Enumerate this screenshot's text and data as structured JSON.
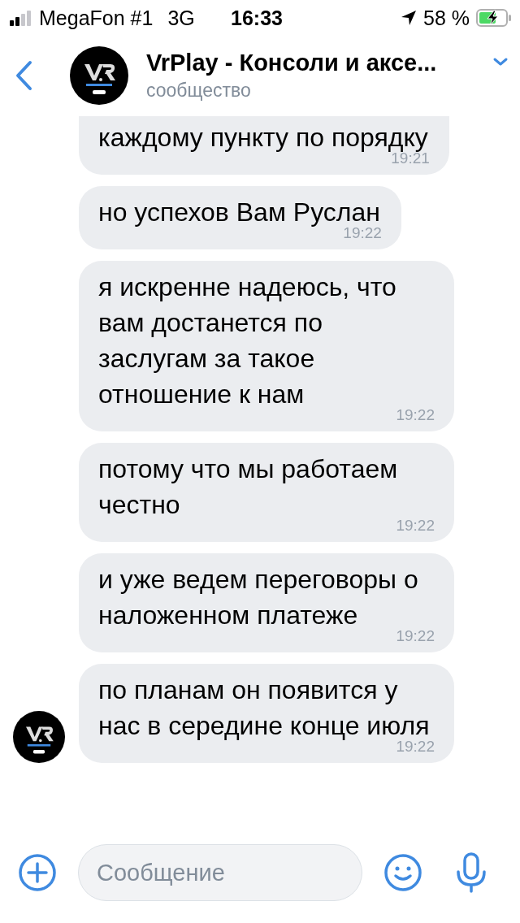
{
  "status_bar": {
    "carrier": "MegaFon #1",
    "network": "3G",
    "time": "16:33",
    "battery": "58 %"
  },
  "header": {
    "title": "VrPlay - Консоли и аксе...",
    "subtitle": "сообщество"
  },
  "messages": [
    {
      "text": "каждому пункту по порядку",
      "time": "19:21",
      "avatar": false
    },
    {
      "text": "но успехов Вам Руслан",
      "time": "19:22",
      "avatar": false
    },
    {
      "text": "я искренне надеюсь, что вам достанется по заслугам за такое отношение к нам",
      "time": "19:22",
      "avatar": false
    },
    {
      "text": "потому что мы работаем честно",
      "time": "19:22",
      "avatar": false
    },
    {
      "text": "и уже ведем переговоры о наложенном платеже",
      "time": "19:22",
      "avatar": false
    },
    {
      "text": "по планам он появится у нас в середине конце июля",
      "time": "19:22",
      "avatar": true
    }
  ],
  "composer": {
    "placeholder": "Сообщение"
  }
}
